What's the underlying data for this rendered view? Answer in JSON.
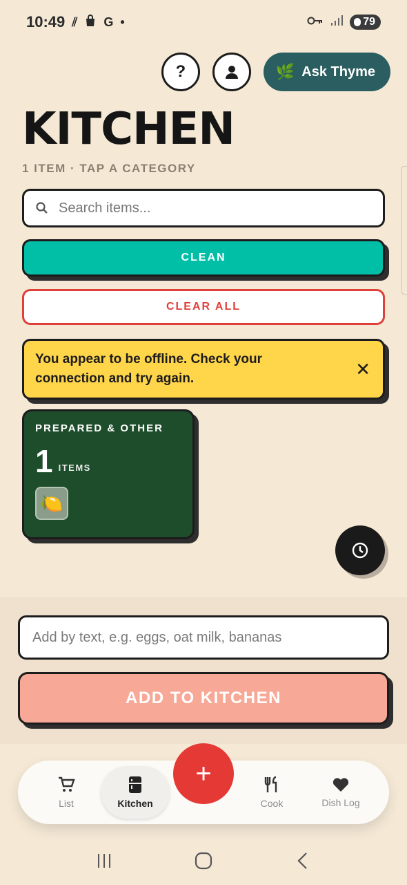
{
  "status": {
    "time": "10:49",
    "carrier_glyph": "G",
    "battery": "79"
  },
  "header": {
    "help_label": "?",
    "ask_label": "Ask Thyme"
  },
  "page": {
    "title": "KITCHEN",
    "subtitle": "1 ITEM · TAP A CATEGORY"
  },
  "search": {
    "placeholder": "Search items..."
  },
  "actions": {
    "clean_label": "CLEAN",
    "clear_all_label": "CLEAR ALL"
  },
  "banner": {
    "message": "You appear to be offline. Check your connection and try again.",
    "close_label": "✕"
  },
  "categories": [
    {
      "name": "PREPARED & OTHER",
      "count": "1",
      "count_label": "ITEMS",
      "item_emoji": "🍋"
    }
  ],
  "add_panel": {
    "placeholder": "Add by text, e.g. eggs, oat milk, bananas",
    "button_label": "ADD TO KITCHEN"
  },
  "nav": {
    "items": [
      {
        "label": "List",
        "icon": "cart-icon"
      },
      {
        "label": "Kitchen",
        "icon": "fridge-icon"
      },
      {
        "label": "Cook",
        "icon": "utensils-icon"
      },
      {
        "label": "Dish Log",
        "icon": "heart-icon"
      }
    ],
    "fab_label": "+"
  },
  "colors": {
    "background": "#f5e9d6",
    "accent_teal": "#2b5e60",
    "clean": "#00bfa6",
    "danger": "#e0403a",
    "banner": "#ffd54a",
    "category_card": "#1e4d2b",
    "add_button": "#f7a896",
    "fab": "#e53935"
  }
}
